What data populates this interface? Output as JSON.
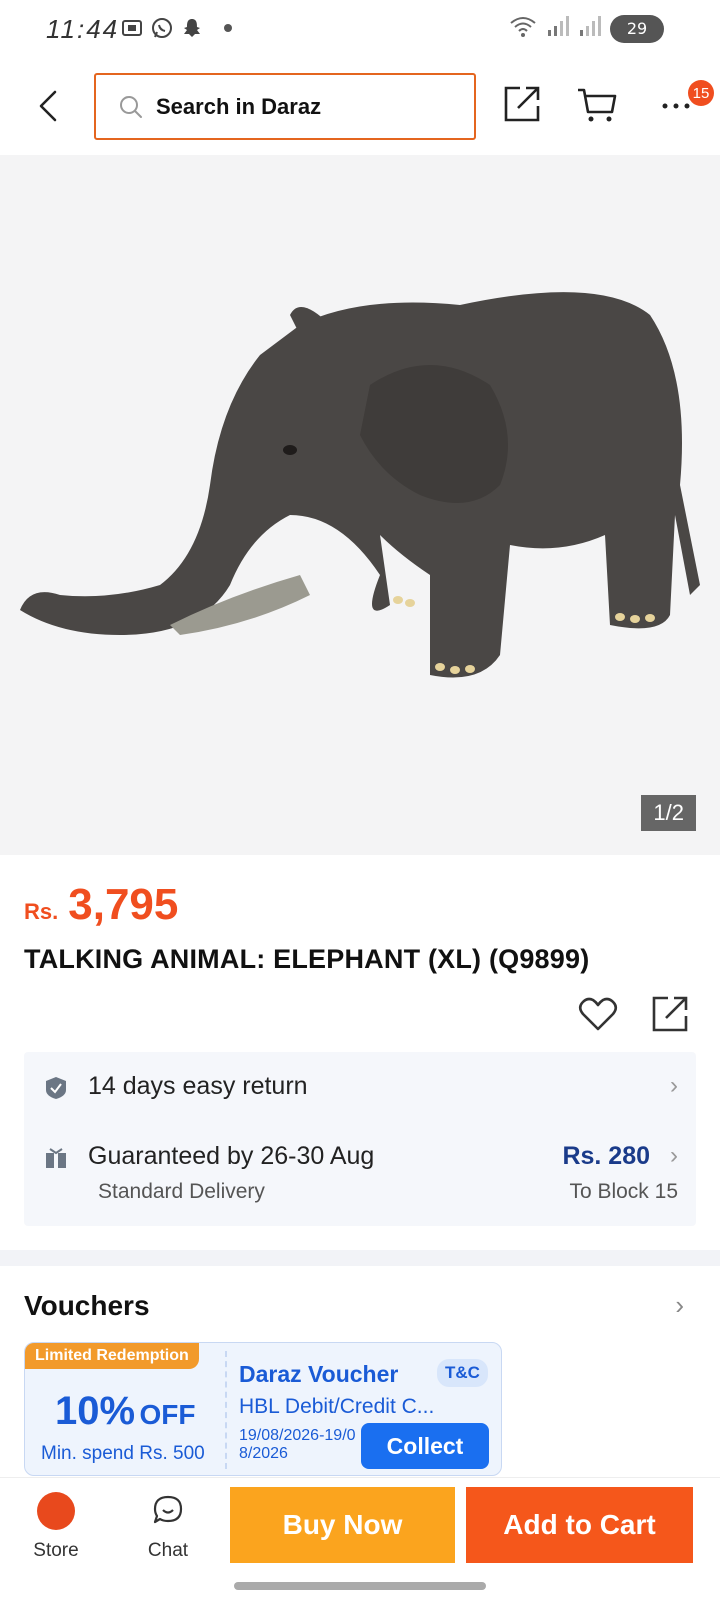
{
  "status_bar": {
    "time": "11:44",
    "battery": "29",
    "icons": [
      "screenshot-icon",
      "whatsapp-icon",
      "snapchat-icon",
      "wifi-icon",
      "signal-icon"
    ]
  },
  "header": {
    "search_placeholder": "Search in Daraz",
    "more_badge": "15"
  },
  "gallery": {
    "counter": "1/2"
  },
  "product": {
    "currency": "Rs.",
    "price": "3,795",
    "title": "TALKING ANIMAL: ELEPHANT (XL) (Q9899)"
  },
  "services": {
    "return_text": "14 days easy return",
    "delivery_text": "Guaranteed by 26-30 Aug",
    "delivery_type": "Standard Delivery",
    "delivery_fee": "Rs. 280",
    "delivery_to": "To Block 15"
  },
  "vouchers": {
    "section_title": "Vouchers",
    "tag": "Limited Redemption",
    "discount_pct": "10%",
    "discount_word": "OFF",
    "min_spend": "Min. spend Rs. 500",
    "name": "Daraz Voucher",
    "tc": "T&C",
    "description": "HBL Debit/Credit C...",
    "validity": "19/08/2026-19/08/2026",
    "collect_label": "Collect"
  },
  "bottom_bar": {
    "store_label": "Store",
    "chat_label": "Chat",
    "buy_now_label": "Buy Now",
    "add_to_cart_label": "Add to Cart"
  },
  "colors": {
    "brand_orange": "#f04e1f",
    "buy_now": "#fba41e",
    "add_to_cart": "#f5571b",
    "voucher_blue": "#1a5bd6"
  }
}
